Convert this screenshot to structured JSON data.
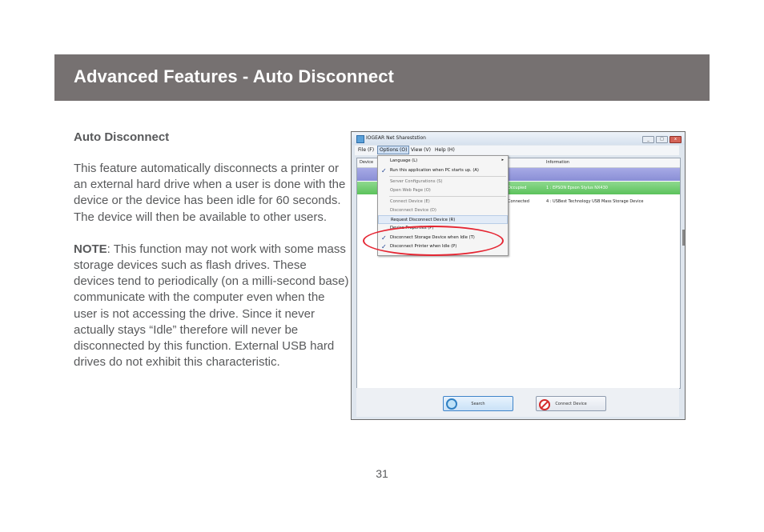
{
  "header": {
    "title": "Advanced Features - Auto Disconnect"
  },
  "body": {
    "heading": "Auto Disconnect",
    "paragraph1": "This feature automatically disconnects a printer or an external hard drive when a user is done with the device or the device has been idle for 60 seconds. The device will then be available to other users.",
    "note_label": "NOTE",
    "note_text": ": This function may not work with some mass storage devices such as flash drives. These devices tend to periodically (on a milli-second base) communicate with the computer even when the user is not accessing the drive. Since it never actually stays “Idle” therefore will never be disconnected by this function. External USB hard drives do not exhibit this characteristic."
  },
  "screenshot": {
    "window_title": "IOGEAR Net Shareststion",
    "window_buttons": [
      "_",
      "□",
      "x"
    ],
    "menu": [
      "File (F)",
      "Options (O)",
      "View (V)",
      "Help (H)"
    ],
    "columns": [
      "Device",
      "Information"
    ],
    "rows": [
      {
        "status": "",
        "info": ""
      },
      {
        "status": "Occupied",
        "info": "1 : EPSON Epson Stylus NX430"
      },
      {
        "status": "Connected",
        "info": "4 : USBest Technology USB Mass Storage Device"
      }
    ],
    "dropdown": [
      {
        "label": "Language (L)",
        "checked": false,
        "submenu": true,
        "disabled": false
      },
      {
        "label": "Run this application when PC starts up. (A)",
        "checked": true,
        "disabled": false
      },
      {
        "label": "Server Configurations (S)",
        "checked": false,
        "disabled": true
      },
      {
        "label": "Open Web Page (O)",
        "checked": false,
        "disabled": true
      },
      {
        "label": "Connect Device (E)",
        "checked": false,
        "disabled": true
      },
      {
        "label": "Disconnect Device (D)",
        "checked": false,
        "disabled": true
      },
      {
        "label": "Request Disconnect Device (R)",
        "checked": false,
        "disabled": false,
        "highlighted": true
      },
      {
        "label": "Device Properties (P)",
        "checked": false,
        "disabled": false
      },
      {
        "label": "Disconnect Storage Device when Idle (T)",
        "checked": true,
        "disabled": false
      },
      {
        "label": "Disconnect Printer when Idle (P)",
        "checked": true,
        "disabled": false
      }
    ],
    "check_glyph": "✓",
    "submenu_glyph": "▸",
    "search_button": "Search",
    "connect_button": "Connect Device",
    "highlight_color": "#e52532"
  },
  "page_number": "31"
}
